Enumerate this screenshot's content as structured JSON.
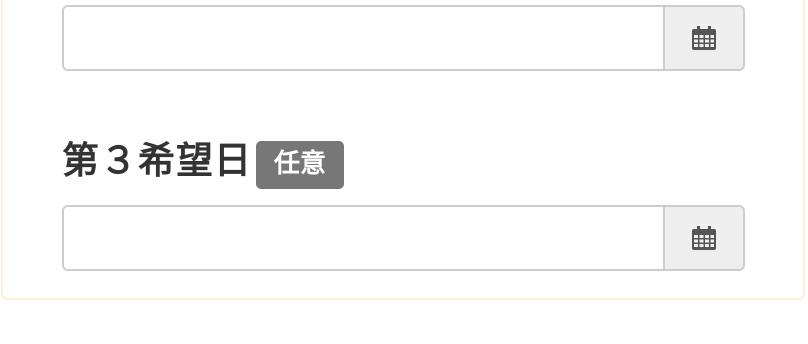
{
  "fields": [
    {
      "label": "",
      "value": "",
      "placeholder": "",
      "icon": "calendar-icon"
    },
    {
      "label": "第３希望日",
      "badge": "任意",
      "value": "",
      "placeholder": "",
      "icon": "calendar-icon"
    }
  ],
  "colors": {
    "card_border": "#fbf0d6",
    "input_border": "#cccccc",
    "addon_bg": "#eeeeee",
    "badge_bg": "#777777",
    "label_text": "#333333",
    "icon": "#555555"
  }
}
